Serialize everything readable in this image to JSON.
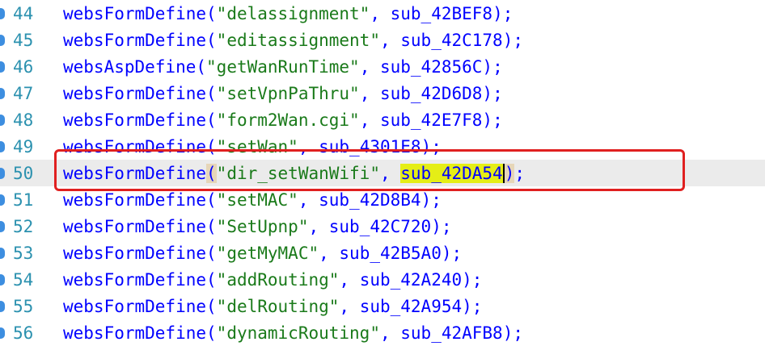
{
  "lines": [
    {
      "num": "44",
      "func": "websFormDefine",
      "arg": "\"delassignment\"",
      "handler": "sub_42BEF8"
    },
    {
      "num": "45",
      "func": "websFormDefine",
      "arg": "\"editassignment\"",
      "handler": "sub_42C178"
    },
    {
      "num": "46",
      "func": "websAspDefine",
      "arg": "\"getWanRunTime\"",
      "handler": "sub_42856C"
    },
    {
      "num": "47",
      "func": "websFormDefine",
      "arg": "\"setVpnPaThru\"",
      "handler": "sub_42D6D8"
    },
    {
      "num": "48",
      "func": "websFormDefine",
      "arg": "\"form2Wan.cgi\"",
      "handler": "sub_42E7F8"
    },
    {
      "num": "49",
      "func": "websFormDefine",
      "arg": "\"setWan\"",
      "handler": "sub_4301E8"
    },
    {
      "num": "50",
      "func": "websFormDefine",
      "arg": "\"dir_setWanWifi\"",
      "handler": "sub_42DA54"
    },
    {
      "num": "51",
      "func": "websFormDefine",
      "arg": "\"setMAC\"",
      "handler": "sub_42D8B4"
    },
    {
      "num": "52",
      "func": "websFormDefine",
      "arg": "\"SetUpnp\"",
      "handler": "sub_42C720"
    },
    {
      "num": "53",
      "func": "websFormDefine",
      "arg": "\"getMyMAC\"",
      "handler": "sub_42B5A0"
    },
    {
      "num": "54",
      "func": "websFormDefine",
      "arg": "\"addRouting\"",
      "handler": "sub_42A240"
    },
    {
      "num": "55",
      "func": "websFormDefine",
      "arg": "\"delRouting\"",
      "handler": "sub_42A954"
    },
    {
      "num": "56",
      "func": "websFormDefine",
      "arg": "\"dynamicRouting\"",
      "handler": "sub_42AFB8"
    }
  ],
  "punct": {
    "open": "(",
    "sep": ", ",
    "close": ");"
  },
  "current_line_index": 6,
  "colors": {
    "keyword": "#0000ff",
    "string": "#1a7a1a",
    "line_number": "#2b91af",
    "current_line_bg": "#ebebeb",
    "word_highlight": "#e5ee16",
    "annotation_box": "#e02020"
  }
}
